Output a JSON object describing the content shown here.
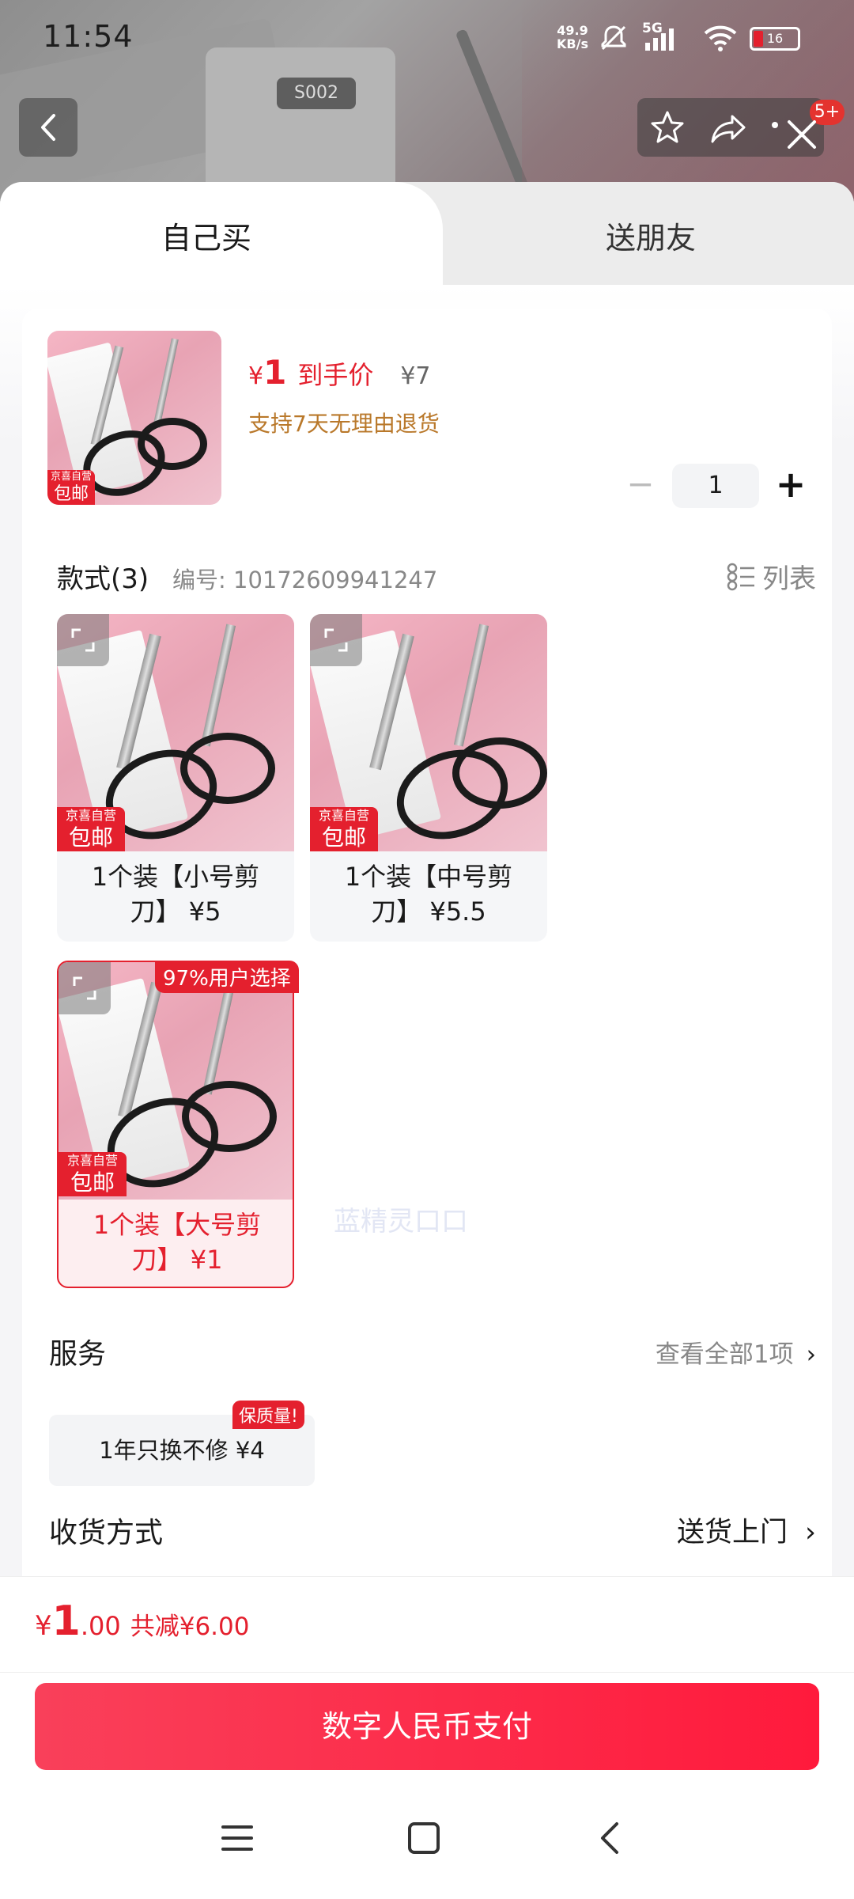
{
  "status_bar": {
    "time": "11:54",
    "net_speed_value": "49.9",
    "net_speed_unit": "KB/s",
    "network": "5G",
    "battery": "16"
  },
  "header": {
    "notification_badge": "5+"
  },
  "tabs": {
    "self": "自己买",
    "friend": "送朋友"
  },
  "product": {
    "free_tag_line1": "京喜自营",
    "free_tag_line2": "包邮",
    "currency": "¥",
    "price": "1",
    "price_note": "到手价",
    "original_price": "¥7",
    "return_policy": "支持7天无理由退货",
    "quantity": "1",
    "minus": "−",
    "plus": "+"
  },
  "styles": {
    "title": "款式(3)",
    "code_label": "编号: 10172609941247",
    "list_toggle": "列表",
    "popular_tag": "97%用户选择",
    "variants": [
      {
        "label_line1": "1个装【小号剪",
        "label_line2": "刀】 ¥5",
        "selected": false
      },
      {
        "label_line1": "1个装【中号剪",
        "label_line2": "刀】 ¥5.5",
        "selected": false
      },
      {
        "label_line1": "1个装【大号剪",
        "label_line2": "刀】 ¥1",
        "selected": true
      }
    ]
  },
  "watermark": "蓝精灵口口",
  "service": {
    "title": "服务",
    "view_all": "查看全部1项",
    "option": "1年只换不修 ¥4",
    "badge": "保质量!"
  },
  "shipping": {
    "title": "收货方式",
    "value": "送货上门"
  },
  "footer": {
    "currency": "¥",
    "total_int": "1",
    "total_dec": ".00",
    "saving": "共减¥6.00",
    "pay_button": "数字人民币支付"
  },
  "colors": {
    "accent": "#e4202e",
    "pay_gradient_start": "#f9405a",
    "pay_gradient_end": "#ff1a3c",
    "return_note": "#b9782a"
  },
  "icons": [
    "back-icon",
    "star-icon",
    "share-icon",
    "close-icon",
    "list-view-icon",
    "expand-icon",
    "chevron-right-icon",
    "menu-icon",
    "home-icon",
    "back-nav-icon"
  ]
}
